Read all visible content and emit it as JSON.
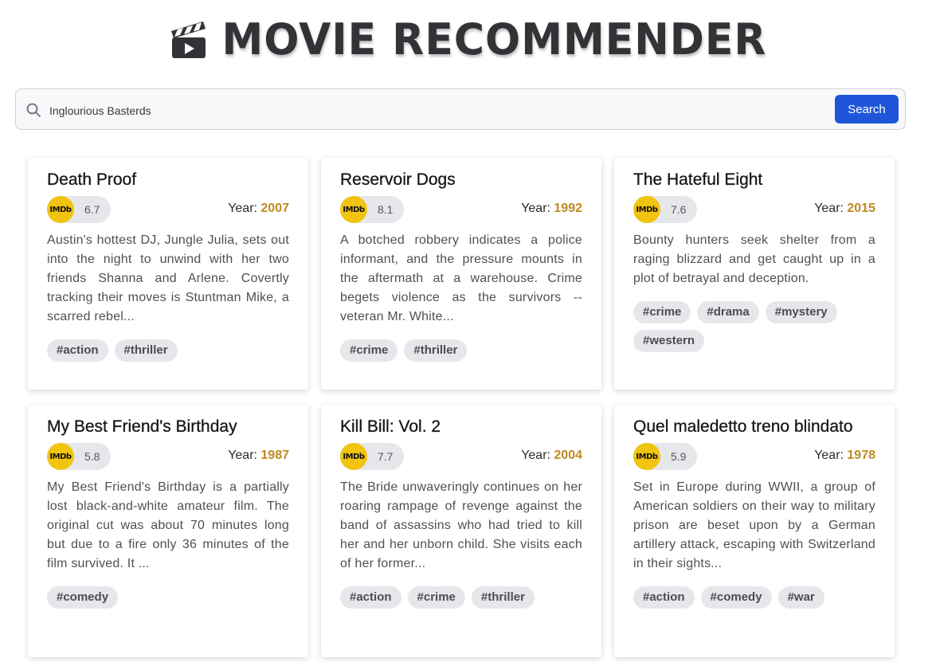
{
  "app": {
    "title": "MOVIE RECOMMENDER"
  },
  "search": {
    "value": "Inglourious Basterds",
    "button_label": "Search"
  },
  "labels": {
    "year_prefix": "Year: ",
    "imdb_badge": "IMDb"
  },
  "colors": {
    "accent_year": "#bf8a1e",
    "imdb_yellow": "#f1c40f",
    "search_button": "#1f55d8"
  },
  "movies": [
    {
      "title": "Death Proof",
      "rating": "6.7",
      "year": "2007",
      "description": "Austin's hottest DJ, Jungle Julia, sets out into the night to unwind with her two friends Shanna and Arlene. Covertly tracking their moves is Stuntman Mike, a scarred rebel...",
      "tags": [
        "#action",
        "#thriller"
      ]
    },
    {
      "title": "Reservoir Dogs",
      "rating": "8.1",
      "year": "1992",
      "description": "A botched robbery indicates a police informant, and the pressure mounts in the aftermath at a warehouse. Crime begets violence as the survivors -- veteran Mr. White...",
      "tags": [
        "#crime",
        "#thriller"
      ]
    },
    {
      "title": "The Hateful Eight",
      "rating": "7.6",
      "year": "2015",
      "description": "Bounty hunters seek shelter from a raging blizzard and get caught up in a plot of betrayal and deception.",
      "tags": [
        "#crime",
        "#drama",
        "#mystery",
        "#western"
      ]
    },
    {
      "title": "My Best Friend's Birthday",
      "rating": "5.8",
      "year": "1987",
      "description": "My Best Friend's Birthday is a partially lost black-and-white amateur film. The original cut was about 70 minutes long but due to a fire only 36 minutes of the film survived. It ...",
      "tags": [
        "#comedy"
      ]
    },
    {
      "title": "Kill Bill: Vol. 2",
      "rating": "7.7",
      "year": "2004",
      "description": "The Bride unwaveringly continues on her roaring rampage of revenge against the band of assassins who had tried to kill her and her unborn child. She visits each of her former...",
      "tags": [
        "#action",
        "#crime",
        "#thriller"
      ]
    },
    {
      "title": "Quel maledetto treno blindato",
      "rating": "5.9",
      "year": "1978",
      "description": "Set in Europe during WWII, a group of American soldiers on their way to military prison are beset upon by a German artillery attack, escaping with Switzerland in their sights...",
      "tags": [
        "#action",
        "#comedy",
        "#war"
      ]
    }
  ]
}
